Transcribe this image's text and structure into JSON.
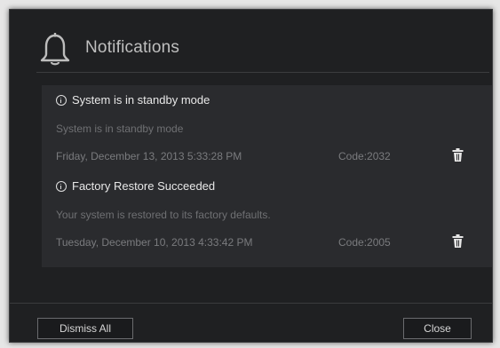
{
  "dialog": {
    "title": "Notifications",
    "icon": "bell-icon"
  },
  "notifications": [
    {
      "title": "System is in standby mode",
      "description": "System is in standby mode",
      "date": "Friday, December 13, 2013 5:33:28 PM",
      "code": "Code:2032"
    },
    {
      "title": "Factory Restore Succeeded",
      "description": "Your system is restored to its factory defaults.",
      "date": "Tuesday, December 10, 2013 4:33:42 PM",
      "code": "Code:2005"
    }
  ],
  "footer": {
    "dismiss_label": "Dismiss All",
    "close_label": "Close"
  },
  "colors": {
    "dialog_bg": "#1f2022",
    "list_bg": "#2a2b2e",
    "title_text": "#bfbfbf",
    "item_title_text": "#e8e8e8",
    "muted_text": "#7a7b7e"
  }
}
